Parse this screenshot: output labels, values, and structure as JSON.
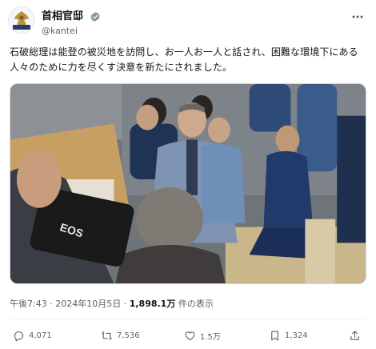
{
  "account": {
    "display_name": "首相官邸",
    "handle": "@kantei"
  },
  "tweet": {
    "text": "石破総理は能登の被災地を訪問し、お一人お一人と話され、困難な環境下にある人々のために力を尽くす決意を新たにされました。"
  },
  "meta": {
    "time": "午後7:43",
    "separator": " · ",
    "date": "2024年10月5日",
    "views_count": "1,898.1万",
    "views_label": " 件の表示"
  },
  "actions": {
    "reply_count": "4,071",
    "retweet_count": "7,536",
    "like_count": "1.5万",
    "bookmark_count": "1,324"
  },
  "icons": {
    "avatar": "government-seal-icon",
    "verified": "verified-badge-icon",
    "more": "more-icon",
    "reply": "reply-icon",
    "retweet": "retweet-icon",
    "like": "heart-icon",
    "bookmark": "bookmark-icon",
    "share": "share-icon"
  },
  "colors": {
    "text": "#0f1419",
    "secondary": "#536471",
    "verified_badge": "#829aab",
    "divider": "#eff3f4"
  },
  "media": {
    "camera_lettering": "EOS"
  }
}
